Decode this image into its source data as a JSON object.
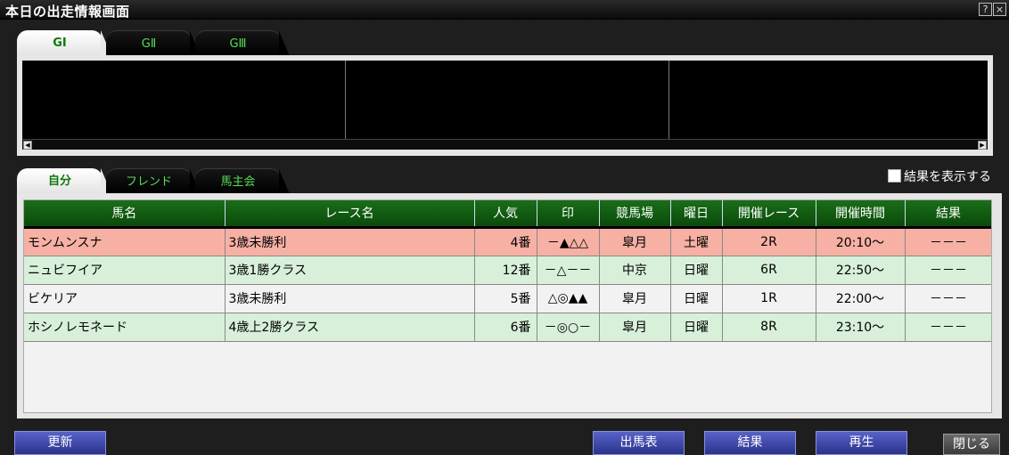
{
  "window": {
    "title": "本日の出走情報画面",
    "help": "?",
    "close": "×"
  },
  "grade_tabs": [
    {
      "label": "GⅠ"
    },
    {
      "label": "GⅡ"
    },
    {
      "label": "GⅢ"
    }
  ],
  "view_tabs": [
    {
      "label": "自分"
    },
    {
      "label": "フレンド"
    },
    {
      "label": "馬主会"
    }
  ],
  "show_results": {
    "label": "結果を表示する",
    "checked": false
  },
  "table": {
    "headers": [
      "馬名",
      "レース名",
      "人気",
      "印",
      "競馬場",
      "曜日",
      "開催レース",
      "開催時間",
      "結果"
    ],
    "rows": [
      [
        "モンムンスナ",
        "3歳未勝利",
        "4番",
        "－▲△△",
        "皐月",
        "土曜",
        "2R",
        "20:10～",
        "－－－"
      ],
      [
        "ニュビフイア",
        "3歳1勝クラス",
        "12番",
        "－△－－",
        "中京",
        "日曜",
        "6R",
        "22:50～",
        "－－－"
      ],
      [
        "ビケリア",
        "3歳未勝利",
        "5番",
        "△◎▲▲",
        "皐月",
        "日曜",
        "1R",
        "22:00～",
        "－－－"
      ],
      [
        "ホシノレモネード",
        "4歳上2勝クラス",
        "6番",
        "－◎○－",
        "皐月",
        "日曜",
        "8R",
        "23:10～",
        "－－－"
      ]
    ]
  },
  "buttons": {
    "refresh": "更新",
    "entries": "出馬表",
    "results": "結果",
    "replay": "再生",
    "close": "閉じる"
  }
}
